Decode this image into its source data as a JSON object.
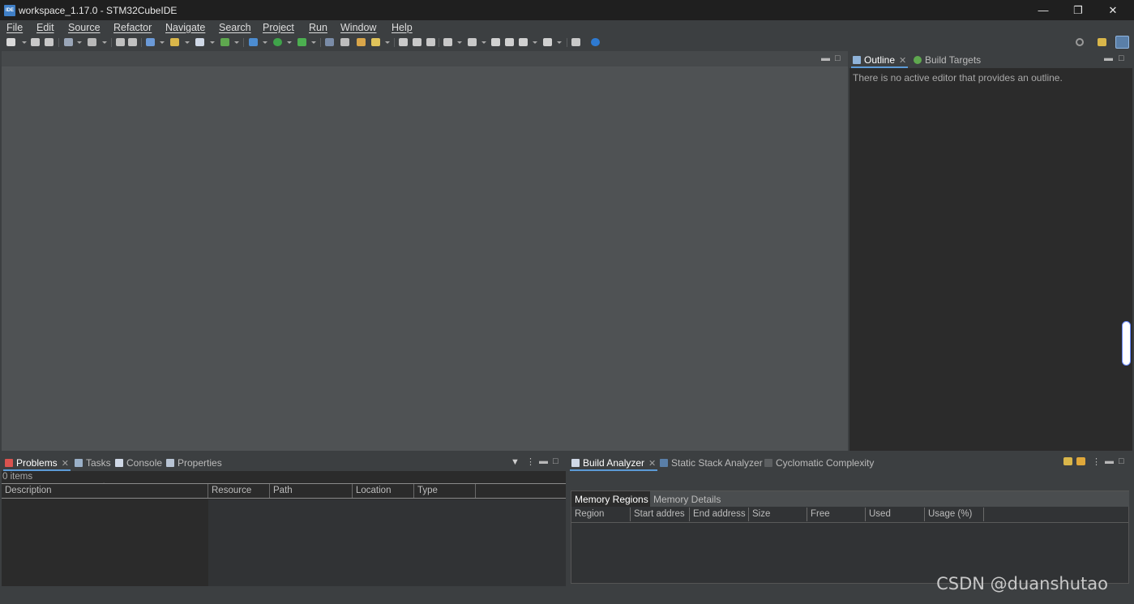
{
  "window": {
    "title": "workspace_1.17.0 - STM32CubeIDE",
    "app_icon_text": "IDE",
    "minimize": "—",
    "restore": "❐",
    "close": "✕"
  },
  "menu": [
    "File",
    "Edit",
    "Source",
    "Refactor",
    "Navigate",
    "Search",
    "Project",
    "Run",
    "Window",
    "Help"
  ],
  "outline": {
    "tabs": [
      {
        "label": "Outline",
        "active": true,
        "closable": true
      },
      {
        "label": "Build Targets",
        "active": false,
        "closable": false
      }
    ],
    "message": "There is no active editor that provides an outline."
  },
  "problems": {
    "tabs": [
      {
        "label": "Problems",
        "active": true,
        "closable": true
      },
      {
        "label": "Tasks",
        "active": false
      },
      {
        "label": "Console",
        "active": false
      },
      {
        "label": "Properties",
        "active": false
      }
    ],
    "count": "0 items",
    "columns": [
      "Description",
      "Resource",
      "Path",
      "Location",
      "Type"
    ]
  },
  "analyzer": {
    "tabs": [
      {
        "label": "Build Analyzer",
        "active": true,
        "closable": true
      },
      {
        "label": "Static Stack Analyzer",
        "active": false
      },
      {
        "label": "Cyclomatic Complexity",
        "active": false
      }
    ],
    "subtabs": [
      "Memory Regions",
      "Memory Details"
    ],
    "columns": [
      "Region",
      "Start addres",
      "End address",
      "Size",
      "Free",
      "Used",
      "Usage (%)"
    ]
  },
  "panel_controls": {
    "minimize": "▬",
    "maximize": "□",
    "view_menu": "⋮",
    "filter": "▼",
    "sort": "^"
  },
  "watermark": "CSDN @duanshutao",
  "colors": {
    "background": "#3c3f41",
    "editor_bg": "#4f5254",
    "view_bg": "#2b2b2b",
    "accent": "#5c9ad6"
  }
}
